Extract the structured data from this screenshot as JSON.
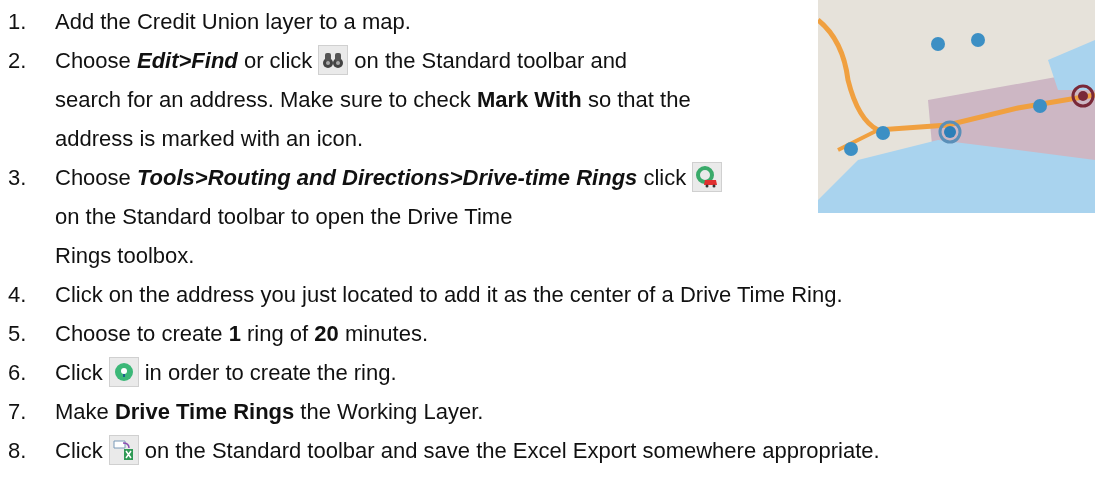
{
  "steps": [
    {
      "number": "1.",
      "kind": "text",
      "before": "Add the Credit Union layer to a map."
    },
    {
      "number": "2.",
      "kind": "with_icon",
      "before": "Choose *Edit>Find* or click",
      "after": "on the Standard toolbar and",
      "continued": "search for an address. Make sure to check **Mark With** so that the address is marked with an icon."
    },
    {
      "number": "3.",
      "kind": "with_icon",
      "before": "Choose *Tools>Routing and Directions>Drive-time Rings* click",
      "after": "on the Standard toolbar to open the Drive Time",
      "continued": "Rings toolbox."
    },
    {
      "number": "4.",
      "kind": "text",
      "before": "Click on the address you just located to add it as the center of a Drive Time Ring."
    },
    {
      "number": "5.",
      "kind": "text",
      "before": "Choose to create **1** ring of **20** minutes."
    },
    {
      "number": "6.",
      "kind": "with_icon",
      "before": "Click",
      "after": "in order to create the ring."
    },
    {
      "number": "7.",
      "kind": "text",
      "before": "Make **Drive Time Rings** the Working Layer."
    },
    {
      "number": "8.",
      "kind": "with_icon",
      "before": "Click",
      "after": "on the Standard toolbar and save the Excel Export somewhere appropriate."
    }
  ]
}
